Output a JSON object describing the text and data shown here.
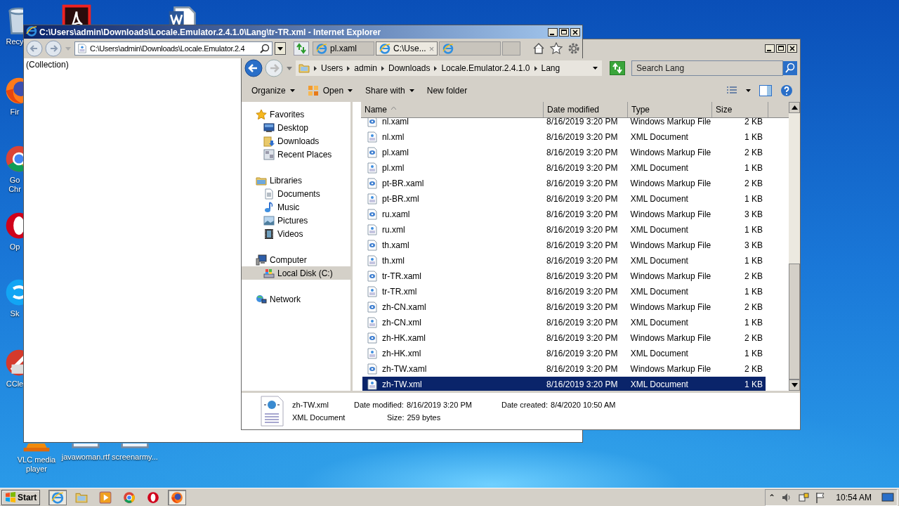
{
  "desktop": {
    "icons": [
      {
        "kind": "bin",
        "label": "Recy"
      },
      {
        "kind": "pdf"
      },
      {
        "kind": "word"
      },
      {
        "kind": "firefox",
        "label": "Fir"
      },
      {
        "kind": "chrome",
        "label": "Go Chr"
      },
      {
        "kind": "opera",
        "label": "Op"
      },
      {
        "kind": "skype",
        "label": "Sk"
      },
      {
        "kind": "ccleaner",
        "label": "CCle"
      },
      {
        "kind": "vlc",
        "label": "VLC media player"
      },
      {
        "kind": "file",
        "label": "javawoman.rtf"
      },
      {
        "kind": "file",
        "label": "screenarmy..."
      }
    ]
  },
  "ie_window": {
    "title": "C:\\Users\\admin\\Downloads\\Locale.Emulator.2.4.1.0\\Lang\\tr-TR.xml - Internet Explorer",
    "address": "C:\\Users\\admin\\Downloads\\Locale.Emulator.2.4",
    "tabs": [
      {
        "label": "pl.xaml",
        "selected": false
      },
      {
        "label": "C:\\Use...",
        "selected": true,
        "close": "×"
      },
      {
        "selected": false
      }
    ],
    "content": "(Collection)"
  },
  "explorer": {
    "breadcrumb": [
      "Users",
      "admin",
      "Downloads",
      "Locale.Emulator.2.4.1.0",
      "Lang"
    ],
    "search": {
      "placeholder": "Search Lang"
    },
    "toolbar": [
      {
        "label": "Organize",
        "icon": false,
        "dropdown": true
      },
      {
        "label": "Open",
        "icon": true,
        "dropdown": true
      },
      {
        "label": "Share with",
        "icon": false,
        "dropdown": true
      },
      {
        "label": "New folder",
        "icon": false,
        "dropdown": false
      }
    ],
    "nav": [
      {
        "label": "Favorites",
        "kind": "star",
        "selected": false,
        "children": [
          {
            "label": "Desktop",
            "kind": "desktop",
            "selected": false
          },
          {
            "label": "Downloads",
            "kind": "downloads",
            "selected": false
          },
          {
            "label": "Recent Places",
            "kind": "recent",
            "selected": false
          }
        ]
      },
      {
        "label": "Libraries",
        "kind": "libraries",
        "selected": false,
        "children": [
          {
            "label": "Documents",
            "kind": "documents",
            "selected": false
          },
          {
            "label": "Music",
            "kind": "music",
            "selected": false
          },
          {
            "label": "Pictures",
            "kind": "pictures",
            "selected": false
          },
          {
            "label": "Videos",
            "kind": "videos",
            "selected": false
          }
        ]
      },
      {
        "label": "Computer",
        "kind": "computer",
        "selected": false,
        "children": [
          {
            "label": "Local Disk (C:)",
            "kind": "disk",
            "selected": true
          }
        ]
      },
      {
        "label": "Network",
        "kind": "network",
        "selected": false
      }
    ],
    "columns": [
      "Name",
      "Date modified",
      "Type",
      "Size"
    ],
    "files": [
      {
        "kind": "xaml",
        "name": "nl.xaml",
        "date": "8/16/2019 3:20 PM",
        "type": "Windows Markup File",
        "size": "2 KB",
        "selected": false
      },
      {
        "kind": "xml",
        "name": "nl.xml",
        "date": "8/16/2019 3:20 PM",
        "type": "XML Document",
        "size": "1 KB",
        "selected": false
      },
      {
        "kind": "xaml",
        "name": "pl.xaml",
        "date": "8/16/2019 3:20 PM",
        "type": "Windows Markup File",
        "size": "2 KB",
        "selected": false
      },
      {
        "kind": "xml",
        "name": "pl.xml",
        "date": "8/16/2019 3:20 PM",
        "type": "XML Document",
        "size": "1 KB",
        "selected": false
      },
      {
        "kind": "xaml",
        "name": "pt-BR.xaml",
        "date": "8/16/2019 3:20 PM",
        "type": "Windows Markup File",
        "size": "2 KB",
        "selected": false
      },
      {
        "kind": "xml",
        "name": "pt-BR.xml",
        "date": "8/16/2019 3:20 PM",
        "type": "XML Document",
        "size": "1 KB",
        "selected": false
      },
      {
        "kind": "xaml",
        "name": "ru.xaml",
        "date": "8/16/2019 3:20 PM",
        "type": "Windows Markup File",
        "size": "3 KB",
        "selected": false
      },
      {
        "kind": "xml",
        "name": "ru.xml",
        "date": "8/16/2019 3:20 PM",
        "type": "XML Document",
        "size": "1 KB",
        "selected": false
      },
      {
        "kind": "xaml",
        "name": "th.xaml",
        "date": "8/16/2019 3:20 PM",
        "type": "Windows Markup File",
        "size": "3 KB",
        "selected": false
      },
      {
        "kind": "xml",
        "name": "th.xml",
        "date": "8/16/2019 3:20 PM",
        "type": "XML Document",
        "size": "1 KB",
        "selected": false
      },
      {
        "kind": "xaml",
        "name": "tr-TR.xaml",
        "date": "8/16/2019 3:20 PM",
        "type": "Windows Markup File",
        "size": "2 KB",
        "selected": false
      },
      {
        "kind": "xml",
        "name": "tr-TR.xml",
        "date": "8/16/2019 3:20 PM",
        "type": "XML Document",
        "size": "1 KB",
        "selected": false
      },
      {
        "kind": "xaml",
        "name": "zh-CN.xaml",
        "date": "8/16/2019 3:20 PM",
        "type": "Windows Markup File",
        "size": "2 KB",
        "selected": false
      },
      {
        "kind": "xml",
        "name": "zh-CN.xml",
        "date": "8/16/2019 3:20 PM",
        "type": "XML Document",
        "size": "1 KB",
        "selected": false
      },
      {
        "kind": "xaml",
        "name": "zh-HK.xaml",
        "date": "8/16/2019 3:20 PM",
        "type": "Windows Markup File",
        "size": "2 KB",
        "selected": false
      },
      {
        "kind": "xml",
        "name": "zh-HK.xml",
        "date": "8/16/2019 3:20 PM",
        "type": "XML Document",
        "size": "1 KB",
        "selected": false
      },
      {
        "kind": "xaml",
        "name": "zh-TW.xaml",
        "date": "8/16/2019 3:20 PM",
        "type": "Windows Markup File",
        "size": "2 KB",
        "selected": false
      },
      {
        "kind": "xml",
        "name": "zh-TW.xml",
        "date": "8/16/2019 3:20 PM",
        "type": "XML Document",
        "size": "1 KB",
        "selected": true
      }
    ],
    "details": {
      "name": "zh-TW.xml",
      "type": "XML Document",
      "fields": [
        {
          "label": "Date modified:",
          "value": "8/16/2019 3:20 PM"
        },
        {
          "label": "Size:",
          "value": "259 bytes"
        },
        {
          "label": "Date created:",
          "value": "8/4/2020 10:50 AM"
        }
      ]
    }
  },
  "taskbar": {
    "start": "Start",
    "apps": [
      {
        "kind": "ie",
        "active": true
      },
      {
        "kind": "folder",
        "active": false
      },
      {
        "kind": "media",
        "active": false
      },
      {
        "kind": "chrome",
        "active": false
      },
      {
        "kind": "opera",
        "active": false
      },
      {
        "kind": "firefox",
        "active": true
      }
    ],
    "tray": {
      "expand": "⌃",
      "time": "10:54 AM"
    }
  }
}
